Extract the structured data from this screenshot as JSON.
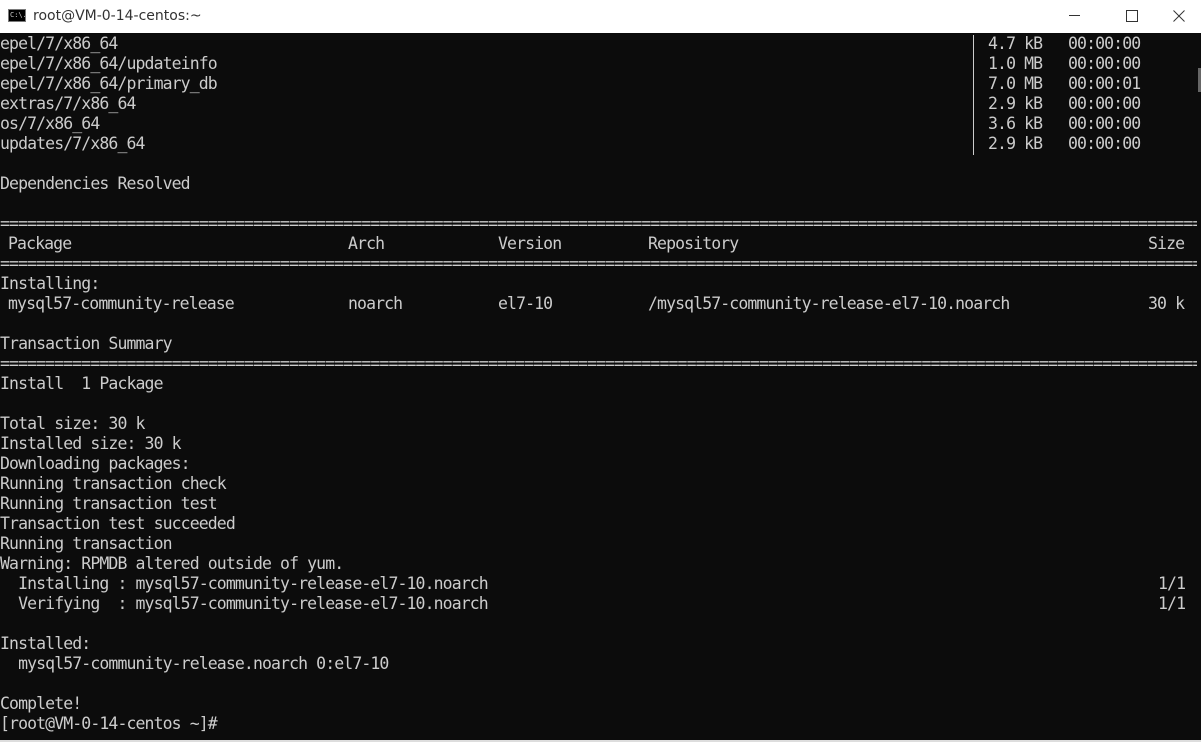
{
  "window": {
    "title": "root@VM-0-14-centos:~",
    "app_icon_text": "C:\\.",
    "controls": {
      "minimize_icon": "minimize-icon",
      "maximize_icon": "maximize-icon",
      "close_icon": "close-icon"
    }
  },
  "terminal": {
    "repo_rows": [
      {
        "name": "epel/7/x86_64",
        "size": "4.7 kB",
        "time": "00:00:00"
      },
      {
        "name": "epel/7/x86_64/updateinfo",
        "size": "1.0 MB",
        "time": "00:00:00"
      },
      {
        "name": "epel/7/x86_64/primary_db",
        "size": "7.0 MB",
        "time": "00:00:01"
      },
      {
        "name": "extras/7/x86_64",
        "size": "2.9 kB",
        "time": "00:00:00"
      },
      {
        "name": "os/7/x86_64",
        "size": "3.6 kB",
        "time": "00:00:00"
      },
      {
        "name": "updates/7/x86_64",
        "size": "2.9 kB",
        "time": "00:00:00"
      }
    ],
    "deps_resolved": "Dependencies Resolved",
    "separator": "================================================================================================================================================================================================================================",
    "headers": {
      "package": "Package",
      "arch": "Arch",
      "version": "Version",
      "repository": "Repository",
      "size": "Size"
    },
    "installing_label": "Installing:",
    "package_row": {
      "package": "mysql57-community-release",
      "arch": "noarch",
      "version": "el7-10",
      "repository": "/mysql57-community-release-el7-10.noarch",
      "size": "30 k"
    },
    "transaction_summary": "Transaction Summary",
    "install_count": "Install  1 Package",
    "total_size": "Total size: 30 k",
    "installed_size": "Installed size: 30 k",
    "downloading": "Downloading packages:",
    "running_check": "Running transaction check",
    "running_test": "Running transaction test",
    "test_succeeded": "Transaction test succeeded",
    "running_transaction": "Running transaction",
    "warning": "Warning: RPMDB altered outside of yum.",
    "installing_step": "  Installing : mysql57-community-release-el7-10.noarch",
    "installing_progress": "1/1",
    "verifying_step": "  Verifying  : mysql57-community-release-el7-10.noarch",
    "verifying_progress": "1/1",
    "installed_label": "Installed:",
    "installed_package": "  mysql57-community-release.noarch 0:el7-10",
    "complete": "Complete!",
    "prompt": "[root@VM-0-14-centos ~]#"
  }
}
